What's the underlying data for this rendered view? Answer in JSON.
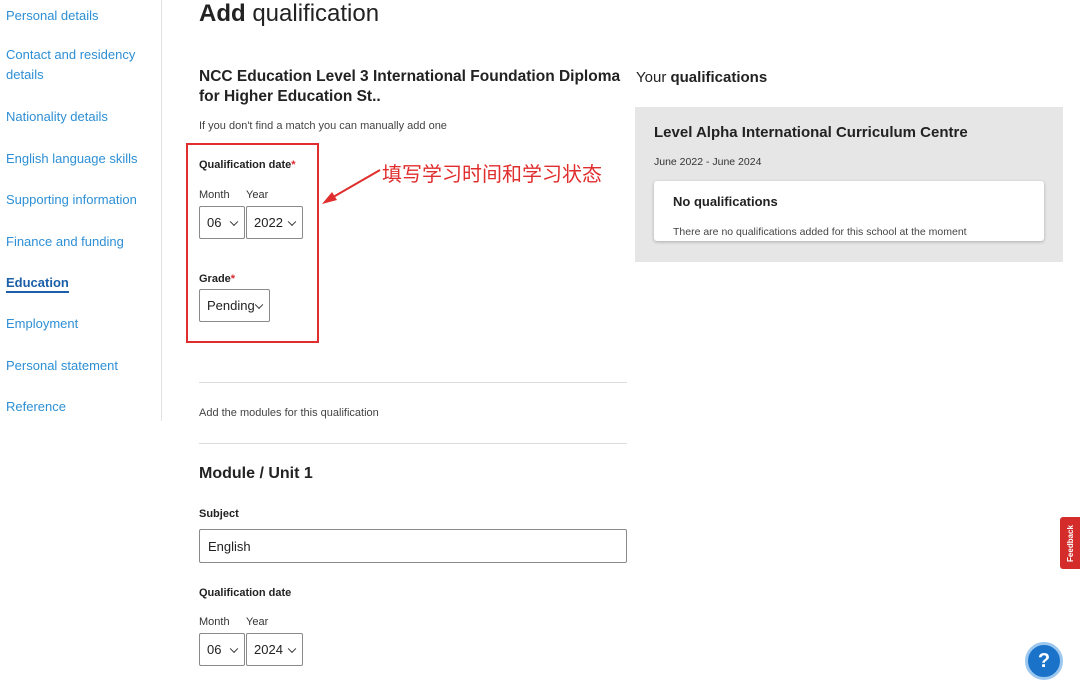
{
  "sidebar": {
    "items": [
      {
        "label": "Personal details",
        "active": false
      },
      {
        "label": "Contact and residency details",
        "active": false
      },
      {
        "label": "Nationality details",
        "active": false
      },
      {
        "label": "English language skills",
        "active": false
      },
      {
        "label": "Supporting information",
        "active": false
      },
      {
        "label": "Finance and funding",
        "active": false
      },
      {
        "label": "Education",
        "active": true
      },
      {
        "label": "Employment",
        "active": false
      },
      {
        "label": "Personal statement",
        "active": false
      },
      {
        "label": "Reference",
        "active": false
      }
    ]
  },
  "page": {
    "title_bold": "Add",
    "title_rest": "qualification"
  },
  "qualification": {
    "name": "NCC Education Level 3 International Foundation Diploma for Higher Education St..",
    "manual_text": "If you don't find a match you can manually add one",
    "date_label": "Qualification date",
    "required_mark": "*",
    "month_label": "Month",
    "year_label": "Year",
    "month_value": "06",
    "year_value": "2022",
    "grade_label": "Grade",
    "grade_value": "Pending"
  },
  "annotation": {
    "text": "填写学习时间和学习状态",
    "color": "#e02d2d"
  },
  "modules": {
    "intro_text": "Add the modules for this qualification",
    "heading": "Module / Unit 1",
    "subject_label": "Subject",
    "subject_value": "English",
    "date_label": "Qualification date",
    "month_label": "Month",
    "year_label": "Year",
    "month_value": "06",
    "year_value": "2024"
  },
  "right_panel": {
    "heading_light": "Your",
    "heading_bold": "qualifications",
    "school_name": "Level Alpha International Curriculum Centre",
    "school_dates": "June 2022 - June 2024",
    "no_quals_title": "No qualifications",
    "no_quals_text": "There are no qualifications added for this school at the moment"
  },
  "feedback": {
    "label": "Feedback"
  },
  "help": {
    "label": "?"
  },
  "icons": {
    "select": "chevron-down-icon",
    "annotation": "arrow-icon"
  },
  "colors": {
    "link": "#2d8fd5",
    "active_link": "#1a5fa8",
    "highlight": "#e02d2d",
    "help_button": "#1a73c9",
    "feedback_tab": "#d42b2b"
  }
}
